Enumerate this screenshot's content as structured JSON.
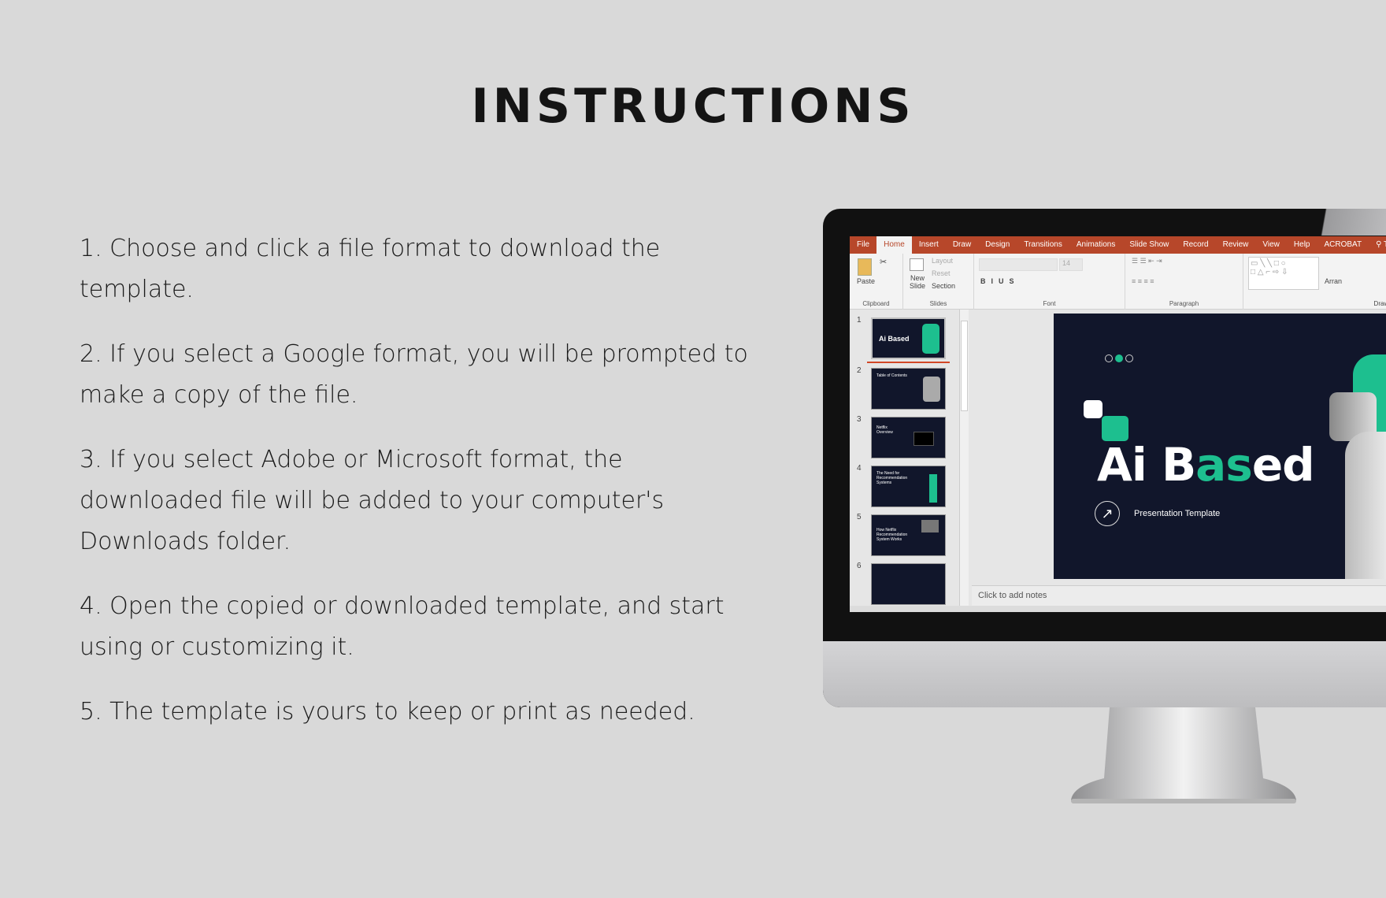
{
  "title": "INSTRUCTIONS",
  "steps": [
    "1. Choose and click a file format to download the template.",
    "2. If you select a Google format, you will be prompted to make a copy of the file.",
    "3. If you select Adobe or Microsoft format, the downloaded file will be added to your computer's Downloads folder.",
    "4. Open the copied or downloaded template, and start using or customizing it.",
    "5. The template is yours to keep or print as needed."
  ],
  "app": {
    "tabs": [
      "File",
      "Home",
      "Insert",
      "Draw",
      "Design",
      "Transitions",
      "Animations",
      "Slide Show",
      "Record",
      "Review",
      "View",
      "Help",
      "ACROBAT",
      "Te"
    ],
    "active_tab": "Home",
    "ribbon": {
      "paste": "Paste",
      "new_slide": "New Slide",
      "layout": "Layout",
      "reset": "Reset",
      "section": "Section",
      "font_size": "14",
      "arrange": "Arran",
      "groups": [
        "Clipboard",
        "Slides",
        "Font",
        "Paragraph",
        "Drawi"
      ]
    },
    "slide_numbers": [
      "1",
      "2",
      "3",
      "4",
      "5",
      "6"
    ],
    "thumb_titles": [
      "Ai Based",
      "Table of Contents",
      "Netflix Overview",
      "The Need for Recommendation Systems",
      "How Netflix Recommendation System Works",
      ""
    ],
    "slide": {
      "title_a": "Ai B",
      "title_b": "as",
      "title_c": "ed",
      "subtitle": "Presentation Template"
    },
    "notes_placeholder": "Click to add notes",
    "colors": {
      "accent": "#1dbf8f",
      "ribbon": "#b7472a",
      "slide_bg": "#11162b"
    }
  }
}
